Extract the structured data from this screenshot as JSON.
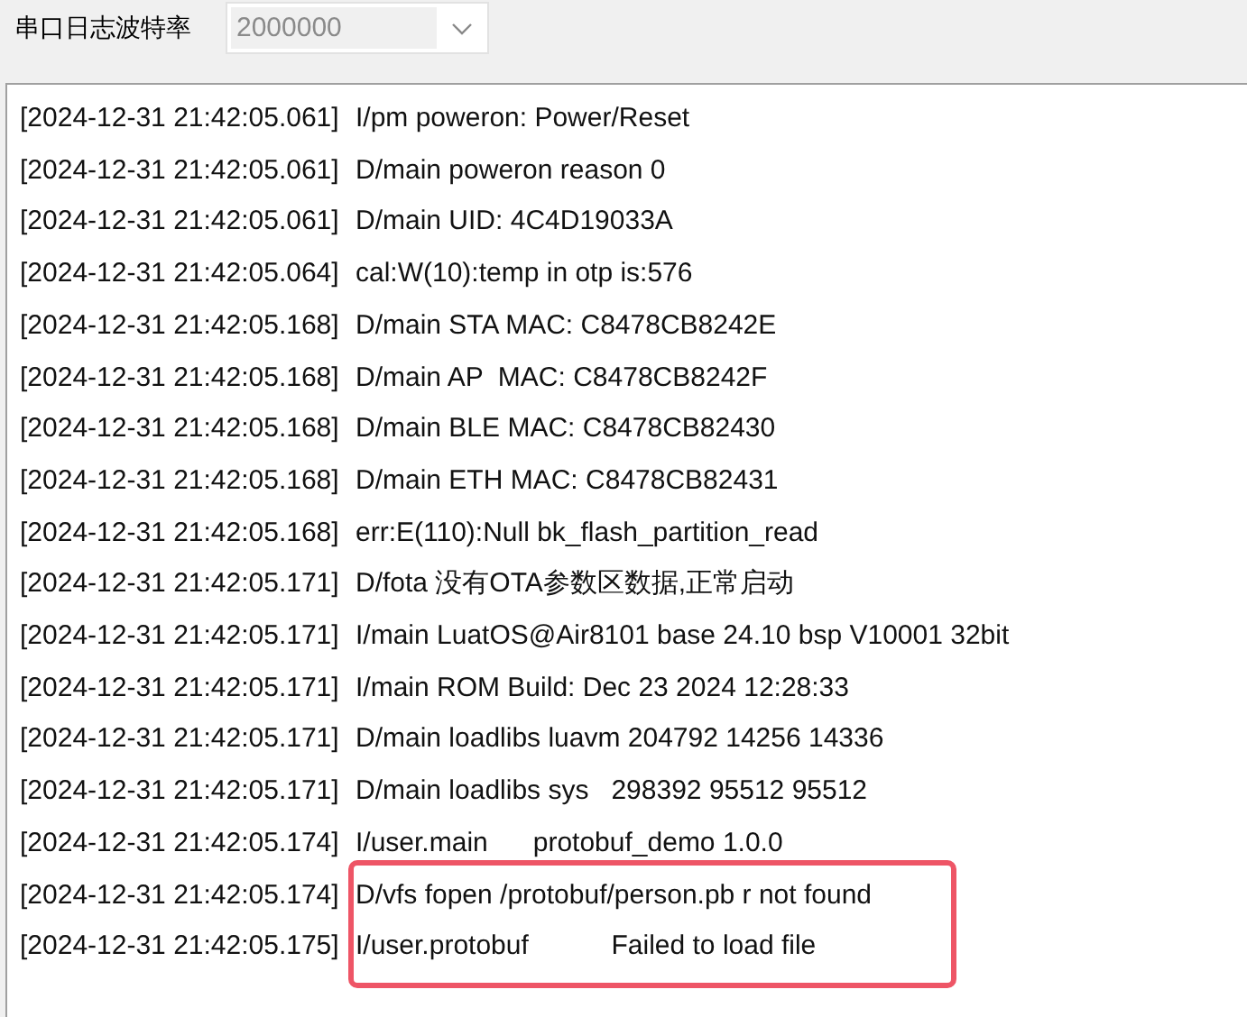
{
  "baud_rate": {
    "label": "串口日志波特率",
    "value": "2000000",
    "disabled": true
  },
  "log": [
    {
      "timestamp": "[2024-12-31 21:42:05.061]",
      "message": "I/pm poweron: Power/Reset",
      "highlighted": false
    },
    {
      "timestamp": "[2024-12-31 21:42:05.061]",
      "message": "D/main poweron reason 0",
      "highlighted": false
    },
    {
      "timestamp": "[2024-12-31 21:42:05.061]",
      "message": "D/main UID: 4C4D19033A",
      "highlighted": false
    },
    {
      "timestamp": "[2024-12-31 21:42:05.064]",
      "message": "cal:W(10):temp in otp is:576",
      "highlighted": false
    },
    {
      "timestamp": "[2024-12-31 21:42:05.168]",
      "message": "D/main STA MAC: C8478CB8242E",
      "highlighted": false
    },
    {
      "timestamp": "[2024-12-31 21:42:05.168]",
      "message": "D/main AP  MAC: C8478CB8242F",
      "highlighted": false
    },
    {
      "timestamp": "[2024-12-31 21:42:05.168]",
      "message": "D/main BLE MAC: C8478CB82430",
      "highlighted": false
    },
    {
      "timestamp": "[2024-12-31 21:42:05.168]",
      "message": "D/main ETH MAC: C8478CB82431",
      "highlighted": false
    },
    {
      "timestamp": "[2024-12-31 21:42:05.168]",
      "message": "err:E(110):Null bk_flash_partition_read",
      "highlighted": false
    },
    {
      "timestamp": "[2024-12-31 21:42:05.171]",
      "message": "D/fota 没有OTA参数区数据,正常启动",
      "highlighted": false
    },
    {
      "timestamp": "[2024-12-31 21:42:05.171]",
      "message": "I/main LuatOS@Air8101 base 24.10 bsp V10001 32bit",
      "highlighted": false
    },
    {
      "timestamp": "[2024-12-31 21:42:05.171]",
      "message": "I/main ROM Build: Dec 23 2024 12:28:33",
      "highlighted": false
    },
    {
      "timestamp": "[2024-12-31 21:42:05.171]",
      "message": "D/main loadlibs luavm 204792 14256 14336",
      "highlighted": false
    },
    {
      "timestamp": "[2024-12-31 21:42:05.171]",
      "message": "D/main loadlibs sys   298392 95512 95512",
      "highlighted": false
    },
    {
      "timestamp": "[2024-12-31 21:42:05.174]",
      "message": "I/user.main      protobuf_demo 1.0.0",
      "highlighted": false
    },
    {
      "timestamp": "[2024-12-31 21:42:05.174]",
      "message": "D/vfs fopen /protobuf/person.pb r not found",
      "highlighted": true
    },
    {
      "timestamp": "[2024-12-31 21:42:05.175]",
      "message": "I/user.protobuf           Failed to load file",
      "highlighted": true
    }
  ]
}
